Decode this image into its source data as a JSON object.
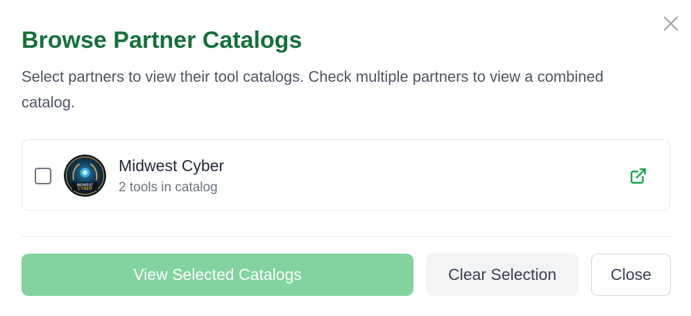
{
  "dialog": {
    "title": "Browse Partner Catalogs",
    "description": "Select partners to view their tool catalogs. Check multiple partners to view a combined catalog.",
    "close_icon": "close-icon"
  },
  "partners": [
    {
      "name": "Midwest Cyber",
      "tool_count_text": "2 tools in catalog",
      "checked": false,
      "logo_icon": "midwest-cyber-logo",
      "link_icon": "external-link-icon"
    }
  ],
  "actions": {
    "view_selected_label": "View Selected Catalogs",
    "clear_selection_label": "Clear Selection",
    "close_label": "Close"
  },
  "colors": {
    "title": "#15703a",
    "primary_button_disabled": "#82d39e",
    "link_icon": "#16a34a",
    "secondary_button_bg": "#f3f4f6"
  }
}
